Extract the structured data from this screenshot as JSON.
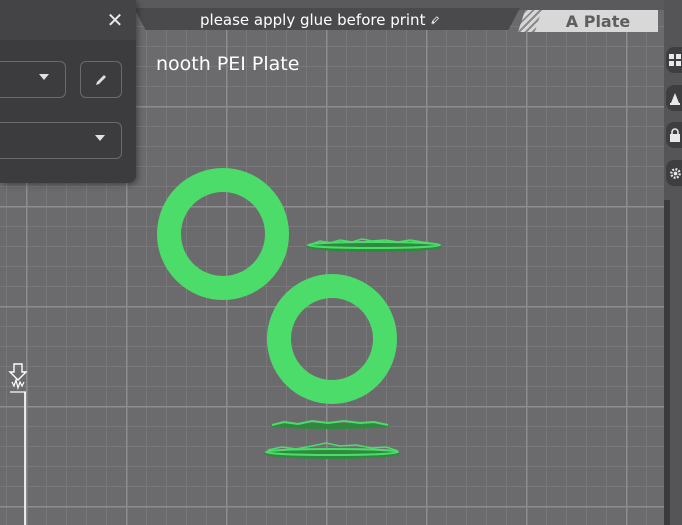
{
  "notice": {
    "text": "please apply glue before print",
    "icon": "pencil-icon"
  },
  "plate_tab": {
    "label": "A Plate"
  },
  "plate_type_label": "nooth PEI Plate",
  "panel": {
    "close_icon": "✕",
    "dropdown_1_value": "",
    "dropdown_2_value": ""
  },
  "colors": {
    "object_green": "#4cdc6a",
    "object_dark_green": "#2f8a3f",
    "plate_background": "#6b6b6d",
    "grid_major": "#8d8d90",
    "grid_minor": "#78787b",
    "panel_background": "#3c3c3e",
    "tab_background": "#d8d8d8"
  },
  "right_toolbar": {
    "icons": [
      "grid-arrange-icon",
      "auto-orient-icon",
      "lock-icon",
      "settings-gear-icon"
    ]
  },
  "layer_slider": {
    "icon": "layer-slider-handle-icon"
  }
}
